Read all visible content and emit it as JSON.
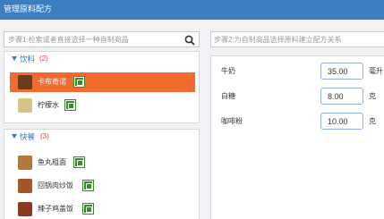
{
  "header": {
    "title": "管理原料配方"
  },
  "step1": {
    "placeholder": "步骤1:检索或者直接选择一种自制商品"
  },
  "step2": {
    "placeholder": "步骤2:为自制商品选择原料建立配方关系"
  },
  "groups": [
    {
      "name": "饮料",
      "count": "(2)",
      "items": [
        {
          "label": "卡布奇诺",
          "selected": true,
          "thumb_color": "#6b3b1e"
        },
        {
          "label": "柠檬水",
          "selected": false,
          "thumb_color": "#d9c28a"
        }
      ]
    },
    {
      "name": "快餐",
      "count": "(3)",
      "items": [
        {
          "label": "鱼丸粗面",
          "selected": false,
          "thumb_color": "#b07a3a"
        },
        {
          "label": "回锅肉炒饭",
          "selected": false,
          "thumb_color": "#a6552a"
        },
        {
          "label": "辣子鸡盖饭",
          "selected": false,
          "thumb_color": "#8a3a1e"
        }
      ]
    }
  ],
  "recipe": [
    {
      "name": "牛奶",
      "value": "35.00",
      "unit": "毫升"
    },
    {
      "name": "白糖",
      "value": "8.00",
      "unit": "克"
    },
    {
      "name": "咖啡粉",
      "value": "10.00",
      "unit": "克"
    }
  ],
  "colors": {
    "header": "#3c7fc0",
    "accent": "#2b7bc8",
    "selected": "#f26a2e",
    "badge": "#3a8a2e"
  },
  "icons": {
    "search": "search-icon",
    "edit": "edit-icon"
  }
}
